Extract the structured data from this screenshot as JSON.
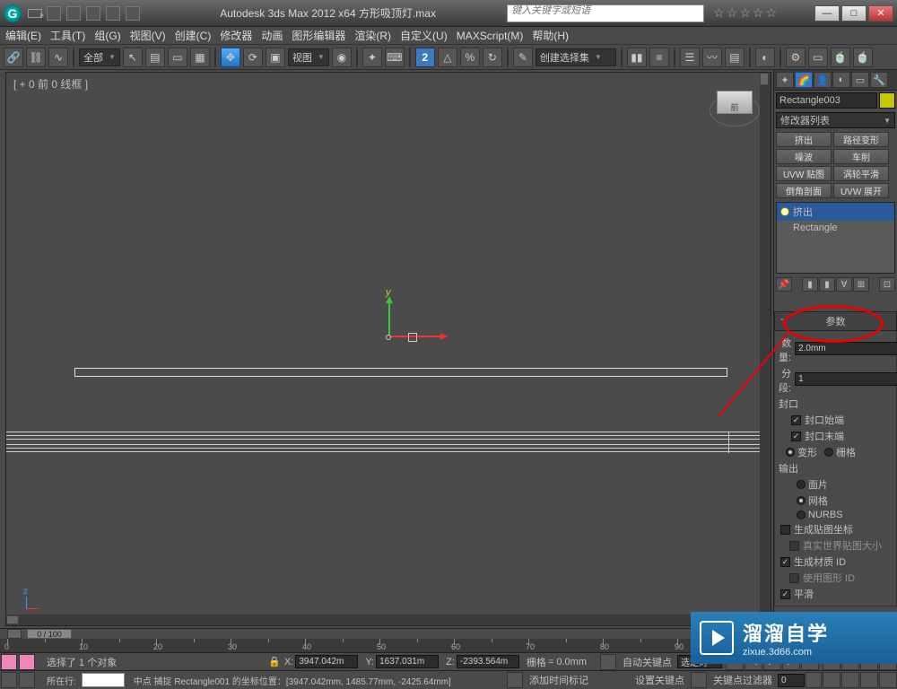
{
  "title": "Autodesk 3ds Max 2012 x64     方形吸顶灯.max",
  "search_placeholder": "键入关键字或短语",
  "menu": [
    "编辑(E)",
    "工具(T)",
    "组(G)",
    "视图(V)",
    "创建(C)",
    "修改器",
    "动画",
    "图形编辑器",
    "渲染(R)",
    "自定义(U)",
    "MAXScript(M)",
    "帮助(H)"
  ],
  "toolbar": {
    "all": "全部",
    "view": "视图",
    "selset": "创建选择集"
  },
  "viewport_label": "[ + 0 前 0 线框 ]",
  "viewcube": "前",
  "y_label": "y",
  "z_label": "z",
  "timeslider": "0 / 100",
  "object_name": "Rectangle003",
  "modifier_list": "修改器列表",
  "mod_buttons": [
    "挤出",
    "路径变形",
    "噪波",
    "车削",
    "UVW 贴图",
    "涡轮平滑",
    "倒角剖面",
    "UVW 展开"
  ],
  "stack": {
    "top": "挤出",
    "base": "Rectangle"
  },
  "rollouts": {
    "params": {
      "header": "参数",
      "amount_lbl": "数量:",
      "amount_val": "2.0mm",
      "seg_lbl": "分段:",
      "seg_val": "1",
      "cap_group": "封口",
      "cap_start": "封口始端",
      "cap_end": "封口末端",
      "morph": "变形",
      "grid": "栅格",
      "out_group": "输出",
      "out_patch": "面片",
      "out_mesh": "网格",
      "out_nurbs": "NURBS",
      "gen_map": "生成贴图坐标",
      "real_world": "真实世界贴图大小",
      "gen_mat": "生成材质 ID",
      "use_shape": "使用图形 ID",
      "smooth": "平滑"
    }
  },
  "status": {
    "selected": "选择了 1 个对象",
    "snap": "中点 捕捉 Rectangle001 的坐标位置：[3947.042mm, 1485.77mm, -2425.64mm]",
    "x_lbl": "X:",
    "x": "3947.042m",
    "y_lbl": "Y:",
    "y": "1637.031m",
    "z_lbl": "Z:",
    "z": "-2393.564m",
    "grid_lbl": "栅格",
    "grid": "= 0.0mm",
    "addtime": "添加时间标记",
    "autokey": "自动关键点",
    "setkey": "设置关键点",
    "selfilter": "选定对",
    "keyfilter": "关键点过滤器",
    "prompt": "所在行:"
  },
  "watermark": {
    "main": "溜溜自学",
    "sub": "zixue.3d66.com"
  }
}
